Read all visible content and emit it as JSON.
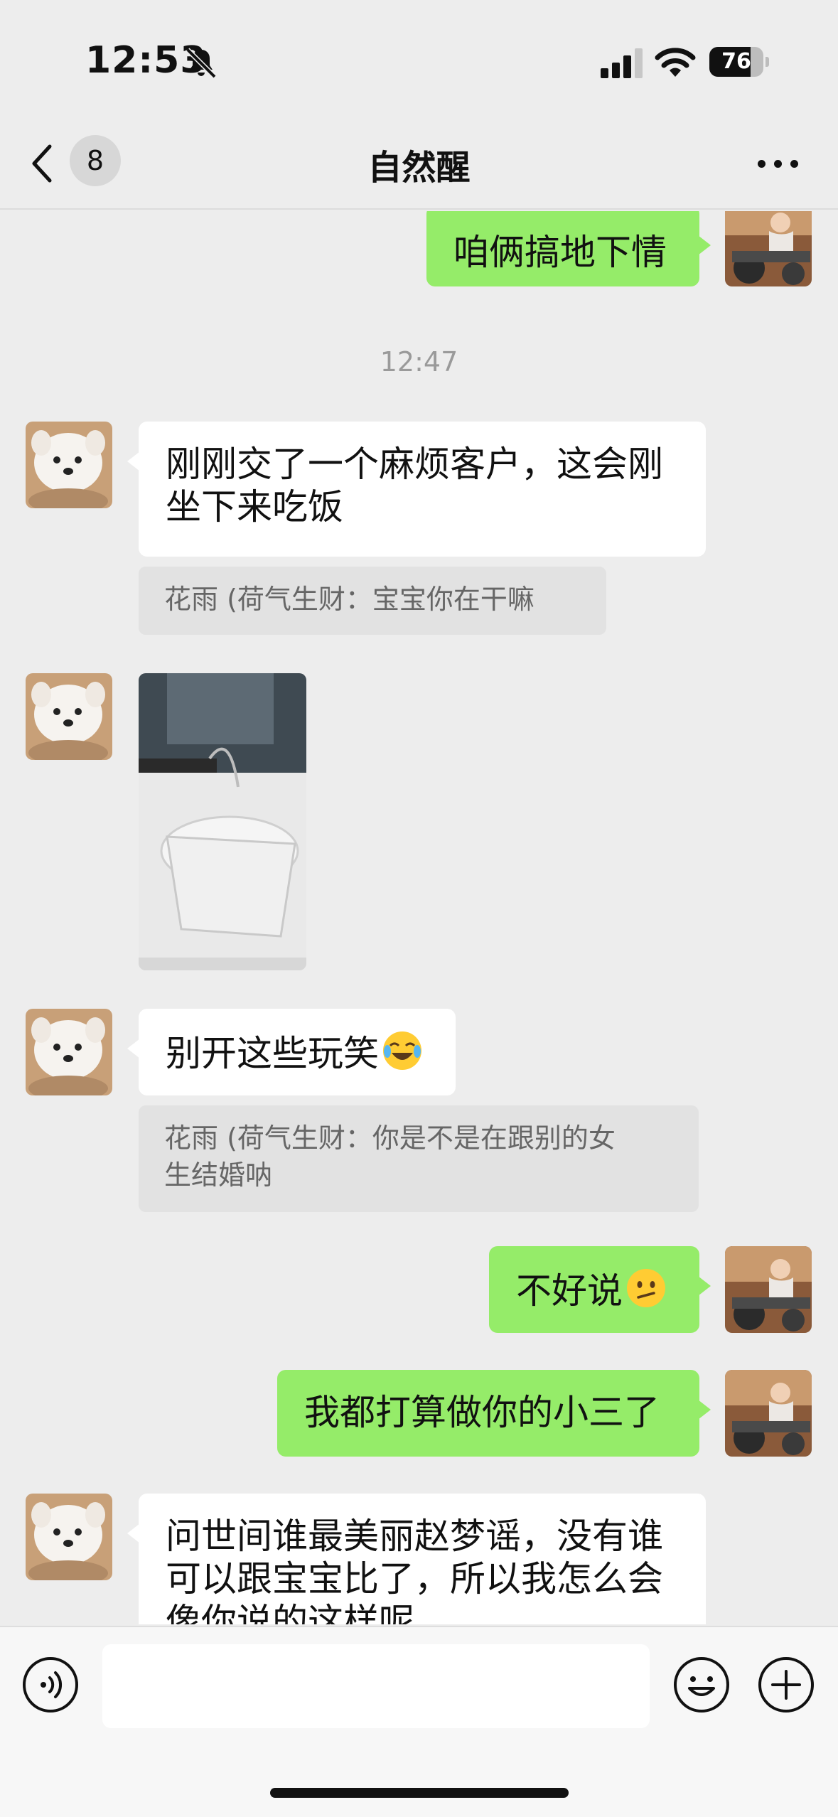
{
  "status_bar": {
    "time": "12:53",
    "battery": "76",
    "battery_level": 0.76
  },
  "nav": {
    "back_badge": "8",
    "title": "自然醒"
  },
  "messages": [
    {
      "side": "right",
      "text": "咱俩搞地下情"
    },
    {
      "type": "timestamp",
      "text": "12:47"
    },
    {
      "side": "left",
      "text_line1": "刚刚交了一个麻烦客户，这会刚",
      "text_line2": "坐下来吃饭"
    },
    {
      "type": "quote",
      "text": "花雨 (荷气生财：宝宝你在干嘛"
    },
    {
      "side": "left",
      "type": "image",
      "image_name": "packed-lunch-photo"
    },
    {
      "side": "left",
      "text": "别开这些玩笑",
      "emoji": "laughing-crying-emoji"
    },
    {
      "type": "quote",
      "text_line1": "花雨 (荷气生财：你是不是在跟别的女",
      "text_line2": "生结婚呐"
    },
    {
      "side": "right",
      "text": "不好说",
      "emoji": "confused-face-emoji"
    },
    {
      "side": "right",
      "text": "我都打算做你的小三了"
    },
    {
      "side": "left",
      "text_line1": "问世间谁最美丽赵梦谣，没有谁",
      "text_line2": "可以跟宝宝比了，所以我怎么会",
      "text_line3": "像你说的这样呢"
    }
  ],
  "input_bar": {
    "placeholder": ""
  },
  "colors": {
    "background": "#ededed",
    "outgoing_bubble": "#95ec69",
    "incoming_bubble": "#ffffff",
    "quote_bg": "#e2e2e2"
  }
}
